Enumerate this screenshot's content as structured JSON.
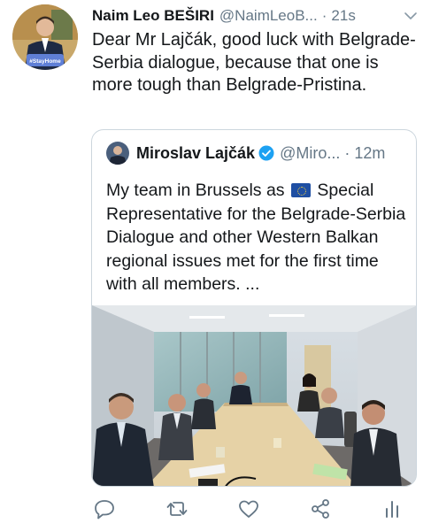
{
  "tweet": {
    "author_name": "Naim Leo BEŠIRI",
    "author_handle": "@NaimLeoB...",
    "separator": "·",
    "time": "21s",
    "avatar_badge": "#StayHome",
    "text": "Dear Mr Lajčák, good luck with Belgrade-Serbia dialogue, because that one is more tough than Belgrade-Pristina."
  },
  "quoted_tweet": {
    "author_name": "Miroslav Lajčák",
    "verified": true,
    "author_handle": "@Miro...",
    "separator": "·",
    "time": "12m",
    "text_before_flag": "My team in Brussels as",
    "flag_icon": "eu-flag-icon",
    "text_after_flag": "Special Representative for the Belgrade-Serbia Dialogue and other Western Balkan regional issues met for the first time with all members. ..."
  },
  "actions": {
    "icons": [
      "reply-icon",
      "retweet-icon",
      "like-icon",
      "share-icon",
      "analytics-icon"
    ]
  },
  "colors": {
    "text": "#14171a",
    "secondary_text": "#657786",
    "accent": "#1da1f2",
    "border": "#ccd6dd",
    "eu_blue": "#1f4fa3"
  }
}
